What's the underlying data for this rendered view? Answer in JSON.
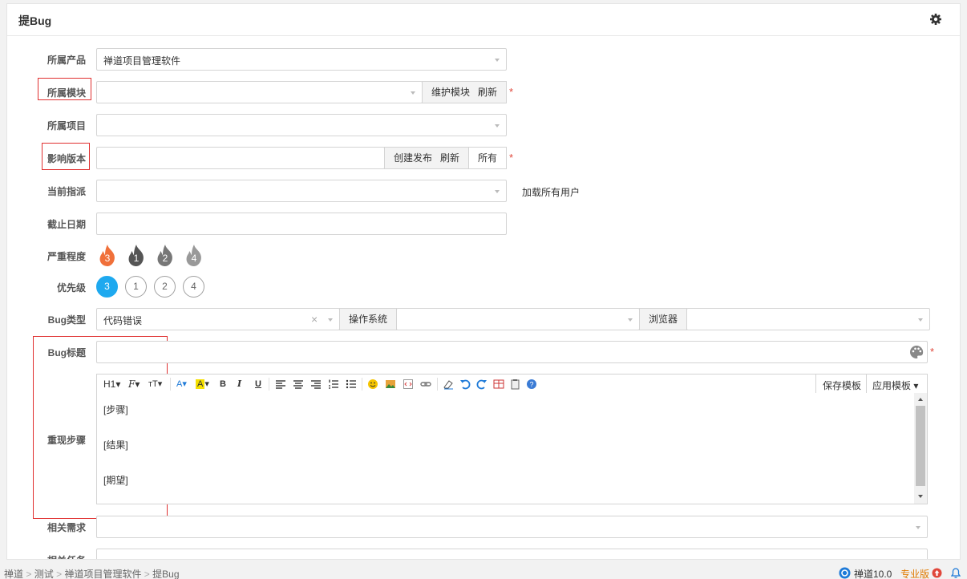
{
  "header": {
    "title": "提Bug"
  },
  "form": {
    "product": {
      "label": "所属产品",
      "value": "禅道项目管理软件"
    },
    "module": {
      "label": "所属模块",
      "value": "",
      "maintain_btn": "维护模块",
      "refresh_btn": "刷新"
    },
    "project": {
      "label": "所属项目",
      "value": ""
    },
    "build": {
      "label": "影响版本",
      "value": "",
      "create_btn": "创建发布",
      "refresh_btn": "刷新",
      "all_btn": "所有"
    },
    "assign": {
      "label": "当前指派",
      "value": "",
      "load_all": "加载所有用户"
    },
    "deadline": {
      "label": "截止日期",
      "value": ""
    },
    "severity": {
      "label": "严重程度",
      "options": [
        "3",
        "1",
        "2",
        "4"
      ],
      "selected": "3"
    },
    "priority": {
      "label": "优先级",
      "options": [
        "3",
        "1",
        "2",
        "4"
      ],
      "selected": "3"
    },
    "type": {
      "label": "Bug类型",
      "value": "代码错误",
      "os_label": "操作系统",
      "os_value": "",
      "browser_label": "浏览器",
      "browser_value": ""
    },
    "bug_title": {
      "label": "Bug标题",
      "value": ""
    },
    "steps": {
      "label": "重现步骤",
      "lines": [
        "[步骤]",
        "[结果]",
        "[期望]"
      ]
    },
    "story": {
      "label": "相关需求",
      "value": ""
    },
    "task": {
      "label": "相关任务",
      "value": ""
    }
  },
  "editor_toolbar": {
    "heading": "H1",
    "font_family": "F",
    "font_size": "тT",
    "font_color": "A",
    "bg_color": "A",
    "bold": "B",
    "italic": "I",
    "underline": "U",
    "save_template": "保存模板",
    "apply_template": "应用模板"
  },
  "colors": {
    "accent": "#1ea9ef",
    "severity_active": "#f0703a",
    "required": "#e0473b",
    "highlight_box": "#e03030"
  },
  "footer": {
    "breadcrumb": [
      "禅道",
      "测试",
      "禅道项目管理软件",
      "提Bug"
    ],
    "separator": ">",
    "version": "禅道10.0",
    "edition": "专业版"
  }
}
